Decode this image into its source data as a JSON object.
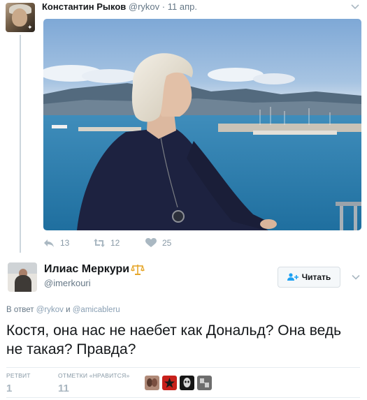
{
  "parent_tweet": {
    "author_name": "Константин Рыков",
    "author_handle": "@rykov",
    "separator": "·",
    "date": "11 апр.",
    "avatar_icon": "user-avatar",
    "reply_count": "13",
    "retweet_count": "12",
    "like_count": "25"
  },
  "reply_tweet": {
    "author_name": "Илиас Меркури",
    "author_handle": "@imerkouri",
    "badge_icon": "scales-icon",
    "follow_label": "Читать",
    "in_reply_prefix": "В ответ",
    "in_reply_handle_1": "@rykov",
    "in_reply_and": "и",
    "in_reply_handle_2": "@amicableru",
    "text": "Костя, она нас не наебет как Дональд? Она ведь не такая? Правда?",
    "retweets_label": "РЕТВИТ",
    "retweets_value": "1",
    "likes_label": "ОТМЕТКИ «НРАВИТСЯ»",
    "likes_value": "11"
  },
  "colors": {
    "text_primary": "#14171a",
    "text_secondary": "#657786",
    "icon_gray": "#8899a6",
    "border": "#e6ecf0",
    "follow_icon_blue": "#1da1f2",
    "badge_gold": "#e6a72b"
  }
}
